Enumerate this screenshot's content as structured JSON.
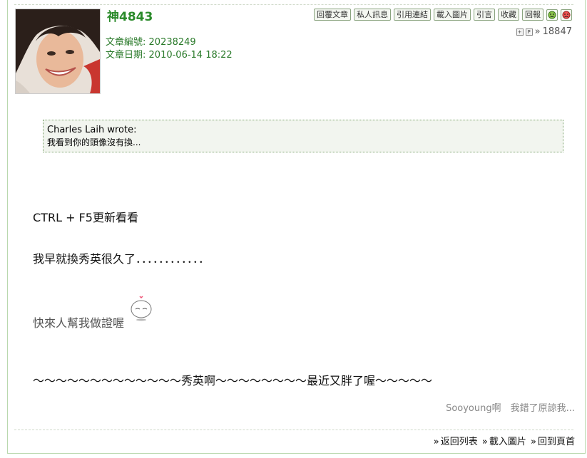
{
  "author": "神4843",
  "meta": {
    "post_no_label": "文章編號:",
    "post_no": "20238249",
    "post_date_label": "文章日期:",
    "post_date": "2010-06-14 18:22"
  },
  "toolbar": {
    "reply_quote": "回覆文章",
    "private_msg": "私人訊息",
    "cite_link": "引用連結",
    "load_images": "載入圖片",
    "quote": "引言",
    "favorite": "收藏",
    "report": "回報",
    "icons": [
      "like-icon",
      "dislike-icon"
    ]
  },
  "stats": {
    "prefix": "»",
    "count": "18847"
  },
  "quote": {
    "author_line": "Charles Laih wrote:",
    "text": "我看到你的頭像沒有換..."
  },
  "body": {
    "line1": "CTRL + F5更新看看",
    "line2": "我早就換秀英很久了．．．．．．．．．．．．",
    "line3": "快來人幫我做證喔",
    "line4": "～～～～～～～～～～～～～秀英啊～～～～～～～～最近又胖了喔～～～～～"
  },
  "signature": "Sooyoung啊　我錯了原諒我...",
  "footer": {
    "back_list": "返回列表",
    "load_images": "載入圖片",
    "top": "回到頁首",
    "sep": "»"
  },
  "colors": {
    "accent": "#2a8a2a",
    "border": "#b9d8ae",
    "quote_bg": "#f2f5ef"
  }
}
